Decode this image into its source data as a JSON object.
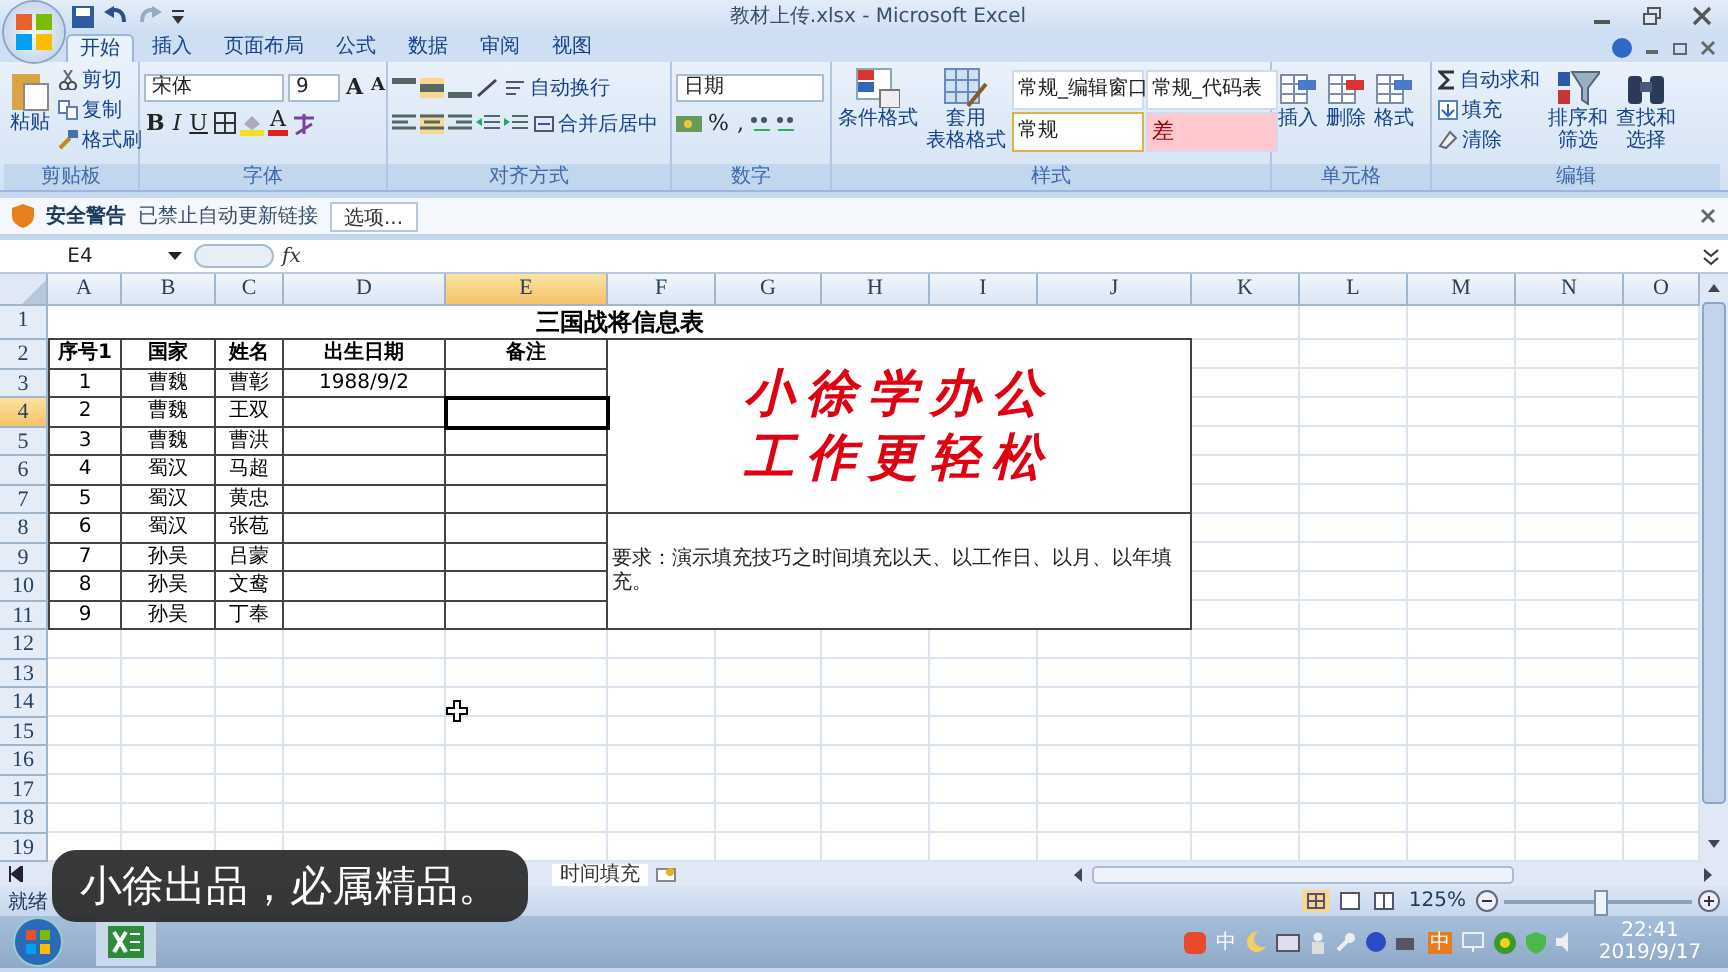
{
  "window": {
    "title": "教材上传.xlsx - Microsoft Excel"
  },
  "tabs": [
    {
      "label": "开始",
      "selected": true
    },
    {
      "label": "插入",
      "selected": false
    },
    {
      "label": "页面布局",
      "selected": false
    },
    {
      "label": "公式",
      "selected": false
    },
    {
      "label": "数据",
      "selected": false
    },
    {
      "label": "审阅",
      "selected": false
    },
    {
      "label": "视图",
      "selected": false
    }
  ],
  "ribbon": {
    "clipboard": {
      "label": "剪贴板",
      "paste": "粘贴",
      "cut": "剪切",
      "copy": "复制",
      "painter": "格式刷"
    },
    "font": {
      "label": "字体",
      "font_name": "宋体",
      "font_size": "9",
      "grow": "A",
      "shrink": "A",
      "bold": "B",
      "italic": "I",
      "underline": "U",
      "font_color_letter": "A"
    },
    "alignment": {
      "label": "对齐方式",
      "wrap": "自动换行",
      "merge": "合并后居中"
    },
    "number": {
      "label": "数字",
      "format": "日期",
      "percent": "%",
      "comma": ","
    },
    "styles": {
      "label": "样式",
      "conditional": "条件格式",
      "table_format_1": "套用",
      "table_format_2": "表格格式",
      "gallery": [
        {
          "label": "常规_编辑窗口",
          "kind": "small",
          "selected": false
        },
        {
          "label": "常规_代码表",
          "kind": "large",
          "selected": false
        },
        {
          "label": "常规",
          "kind": "large",
          "selected": true
        },
        {
          "label": "差",
          "kind": "bad",
          "selected": false
        }
      ]
    },
    "cells": {
      "label": "单元格",
      "buttons": [
        "插入",
        "删除",
        "格式"
      ]
    },
    "editing": {
      "label": "编辑",
      "autosum": "自动求和",
      "fill": "填充",
      "clear": "清除",
      "sort_1": "排序和",
      "sort_2": "筛选",
      "find_1": "查找和",
      "find_2": "选择"
    }
  },
  "security_bar": {
    "title": "安全警告",
    "message": "已禁止自动更新链接",
    "button": "选项..."
  },
  "formula_bar": {
    "name_box": "E4",
    "fx": "fx"
  },
  "sheet": {
    "columns": [
      {
        "label": "A",
        "selected": false
      },
      {
        "label": "B",
        "selected": false
      },
      {
        "label": "C",
        "selected": false
      },
      {
        "label": "D",
        "selected": false
      },
      {
        "label": "E",
        "selected": true
      },
      {
        "label": "F",
        "selected": false
      },
      {
        "label": "G",
        "selected": false
      },
      {
        "label": "H",
        "selected": false
      },
      {
        "label": "I",
        "selected": false
      },
      {
        "label": "J",
        "selected": false
      },
      {
        "label": "K",
        "selected": false
      },
      {
        "label": "L",
        "selected": false
      },
      {
        "label": "M",
        "selected": false
      },
      {
        "label": "N",
        "selected": false
      },
      {
        "label": "O",
        "selected": false
      }
    ],
    "row_numbers": [
      {
        "label": "1",
        "selected": false
      },
      {
        "label": "2",
        "selected": false
      },
      {
        "label": "3",
        "selected": false
      },
      {
        "label": "4",
        "selected": true
      },
      {
        "label": "5",
        "selected": false
      },
      {
        "label": "6",
        "selected": false
      },
      {
        "label": "7",
        "selected": false
      },
      {
        "label": "8",
        "selected": false
      },
      {
        "label": "9",
        "selected": false
      },
      {
        "label": "10",
        "selected": false
      },
      {
        "label": "11",
        "selected": false
      },
      {
        "label": "12",
        "selected": false
      },
      {
        "label": "13",
        "selected": false
      },
      {
        "label": "14",
        "selected": false
      },
      {
        "label": "15",
        "selected": false
      },
      {
        "label": "16",
        "selected": false
      },
      {
        "label": "17",
        "selected": false
      },
      {
        "label": "18",
        "selected": false
      },
      {
        "label": "19",
        "selected": false
      }
    ],
    "title": "三国战将信息表",
    "banner_lines": [
      "小徐学办公",
      "工作更轻松"
    ],
    "note": "要求：演示填充技巧之时间填充以天、以工作日、以月、以年填充。"
  },
  "table": {
    "headers": [
      "序号1",
      "国家",
      "姓名",
      "出生日期",
      "备注"
    ],
    "rows": [
      {
        "no": "1",
        "country": "曹魏",
        "name": "曹彰",
        "birth": "1988/9/2",
        "selected": false
      },
      {
        "no": "2",
        "country": "曹魏",
        "name": "王双",
        "selected": true
      },
      {
        "no": "3",
        "country": "曹魏",
        "name": "曹洪",
        "selected": false
      },
      {
        "no": "4",
        "country": "蜀汉",
        "name": "马超",
        "selected": false
      },
      {
        "no": "5",
        "country": "蜀汉",
        "name": "黄忠",
        "selected": false
      },
      {
        "no": "6",
        "country": "蜀汉",
        "name": "张苞",
        "selected": false
      },
      {
        "no": "7",
        "country": "孙吴",
        "name": "吕蒙",
        "selected": false
      },
      {
        "no": "8",
        "country": "孙吴",
        "name": "文鸯",
        "selected": false
      },
      {
        "no": "9",
        "country": "孙吴",
        "name": "丁奉",
        "selected": false
      }
    ]
  },
  "sheet_tab": "时间填充",
  "caption": "小徐出品，必属精品。",
  "status_bar": {
    "status": "就绪",
    "zoom": "125%",
    "zoom_slider": {
      "level": 0.5
    }
  },
  "taskbar": {
    "tray": [
      {
        "kind": "plain",
        "text": "中"
      },
      {
        "kind": "badge",
        "text": "中"
      }
    ],
    "time": "22:41",
    "date": "2019/9/17"
  }
}
